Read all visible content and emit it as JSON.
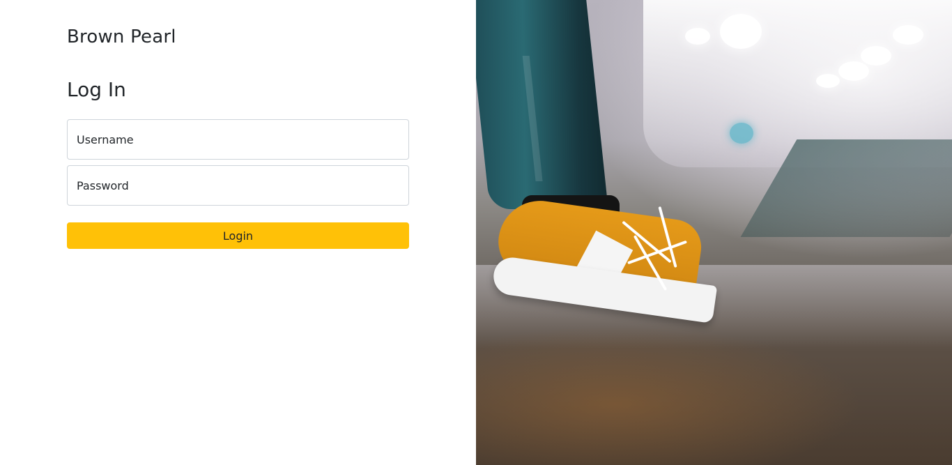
{
  "brand": {
    "name": "Brown Pearl"
  },
  "login": {
    "heading": "Log In",
    "username_placeholder": "Username",
    "password_placeholder": "Password",
    "submit_label": "Login"
  },
  "theme": {
    "accent": "#ffc107",
    "text": "#212529",
    "border": "#ced4da",
    "background": "#ffffff"
  },
  "hero_image": {
    "subject": "person wearing orange sneakers on a subway platform"
  }
}
